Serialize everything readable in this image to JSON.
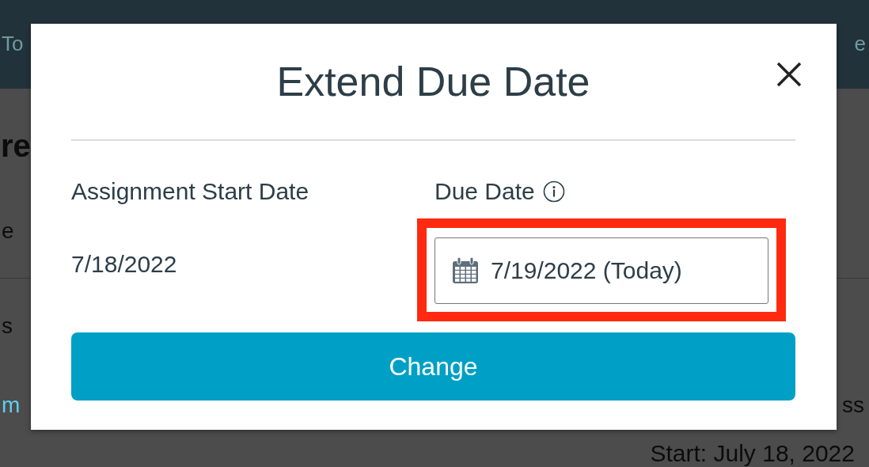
{
  "background": {
    "header_left": "To",
    "header_right": "e",
    "heading": "re",
    "rows": [
      {
        "left": "e"
      },
      {
        "left": "s"
      },
      {
        "left": "m",
        "right": "ss",
        "link": true
      }
    ],
    "start": "Start: July 18, 2022"
  },
  "dialog": {
    "title": "Extend Due Date",
    "start_label": "Assignment Start Date",
    "start_value": "7/18/2022",
    "due_label": "Due Date",
    "due_value": "7/19/2022 (Today)",
    "highlighted": true,
    "button": "Change"
  }
}
